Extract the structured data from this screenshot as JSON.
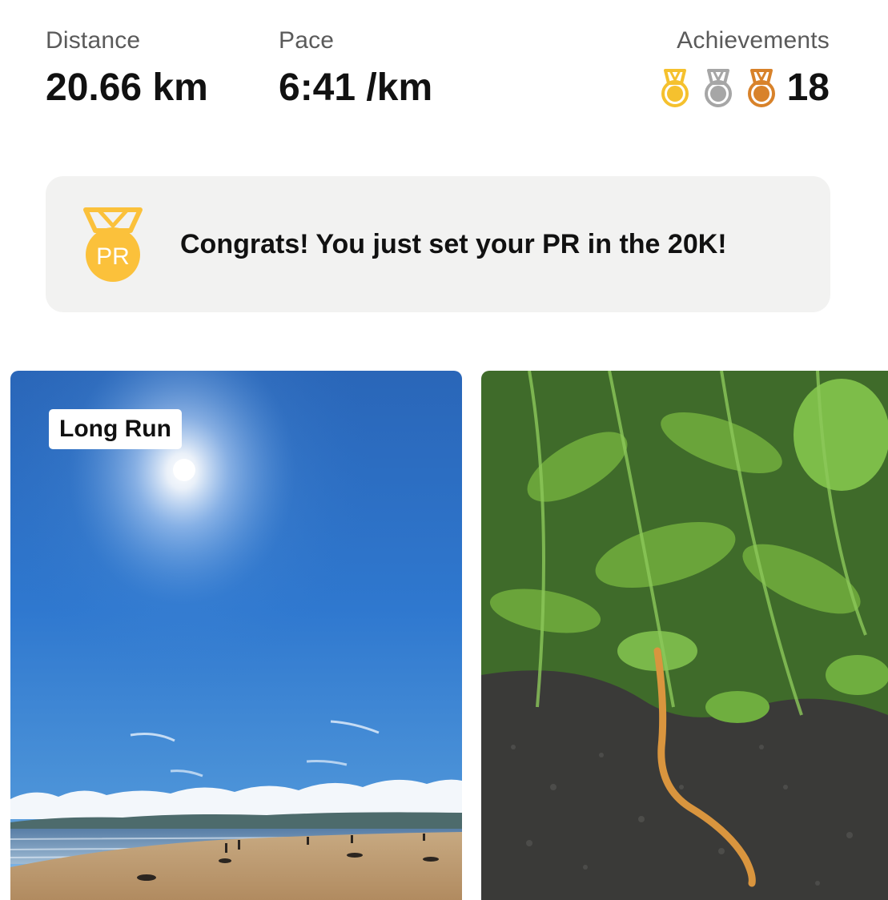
{
  "stats": {
    "distance": {
      "label": "Distance",
      "value": "20.66 km"
    },
    "pace": {
      "label": "Pace",
      "value": "6:41 /km"
    },
    "achievements": {
      "label": "Achievements",
      "count": "18",
      "medals": [
        {
          "icon": "gold-medal-icon",
          "color": "#f5c12e"
        },
        {
          "icon": "silver-medal-icon",
          "color": "#a6a6a6"
        },
        {
          "icon": "bronze-medal-icon",
          "color": "#d8822a"
        }
      ]
    }
  },
  "pr_banner": {
    "icon": "pr-medal-icon",
    "icon_text": "PR",
    "message": "Congrats! You just set your PR in the 20K!",
    "background": "#f2f2f1",
    "accent": "#fbc13b"
  },
  "photos": [
    {
      "name": "beach-photo",
      "tag": "Long Run"
    },
    {
      "name": "grass-slowworm-photo"
    }
  ]
}
